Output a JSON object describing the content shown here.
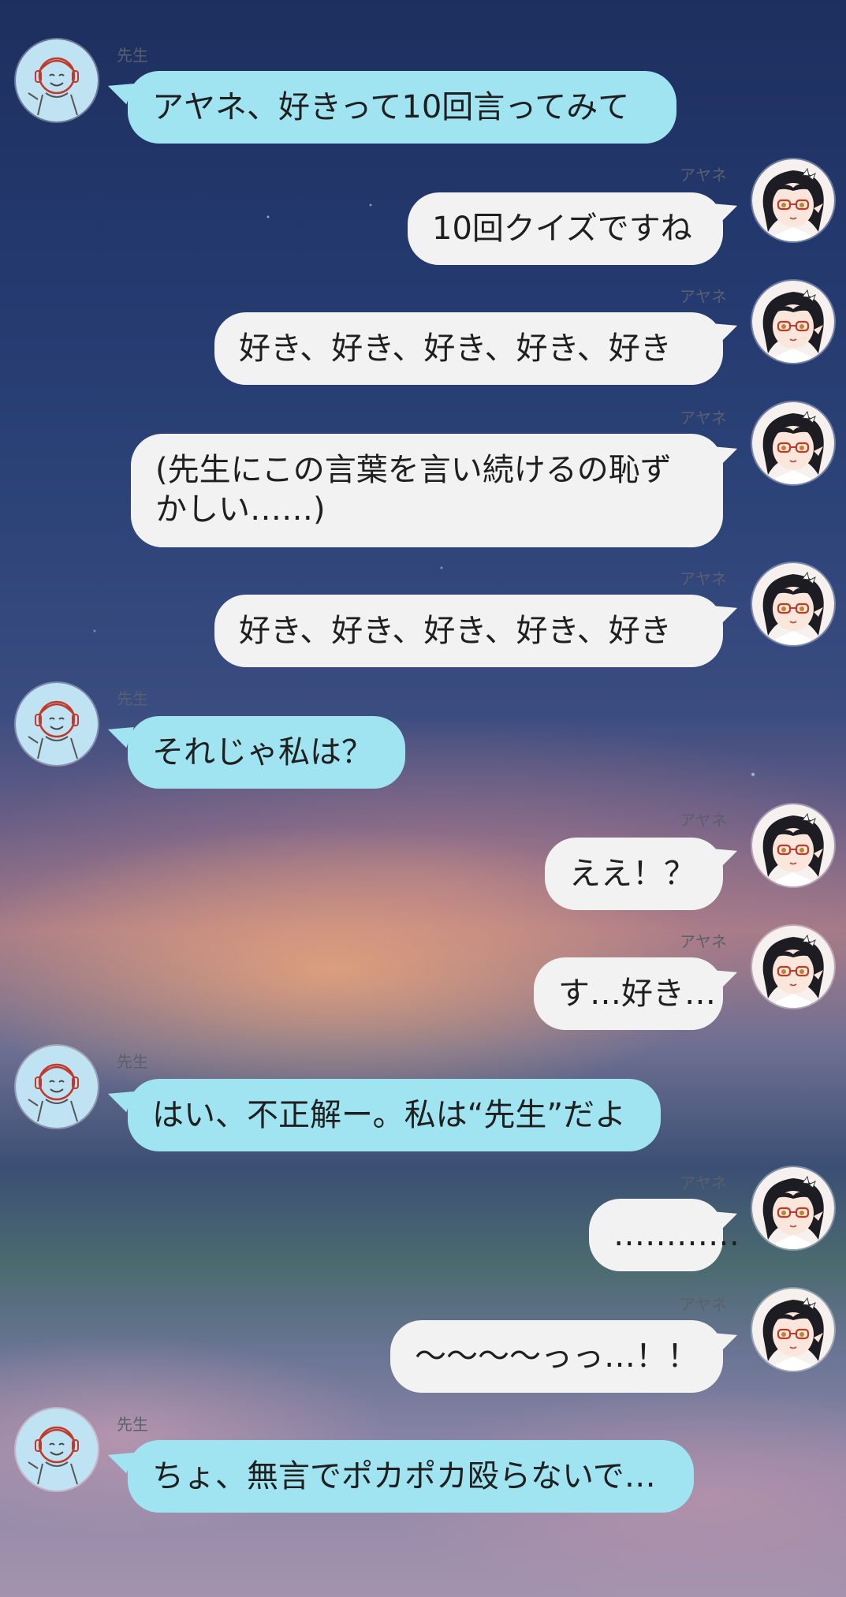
{
  "chat": {
    "participants": {
      "sensei": "先生",
      "ayane": "アヤネ"
    },
    "messages": [
      {
        "from": "sensei",
        "name": "先生",
        "text": "アヤネ、好きって10回言ってみて"
      },
      {
        "from": "ayane",
        "name": "アヤネ",
        "text": "10回クイズですね"
      },
      {
        "from": "ayane",
        "name": "アヤネ",
        "text": "好き、好き、好き、好き、好き"
      },
      {
        "from": "ayane",
        "name": "アヤネ",
        "text": "(先生にこの言葉を言い続けるの恥ずかしい……)"
      },
      {
        "from": "ayane",
        "name": "アヤネ",
        "text": "好き、好き、好き、好き、好き"
      },
      {
        "from": "sensei",
        "name": "先生",
        "text": "それじゃ私は？"
      },
      {
        "from": "ayane",
        "name": "アヤネ",
        "text": "ええ！？"
      },
      {
        "from": "ayane",
        "name": "アヤネ",
        "text": "す…好き…"
      },
      {
        "from": "sensei",
        "name": "先生",
        "text": "はい、不正解ー。私は“先生”だよ"
      },
      {
        "from": "ayane",
        "name": "アヤネ",
        "text": "…………"
      },
      {
        "from": "ayane",
        "name": "アヤネ",
        "text": "〜〜〜〜っっ…！！"
      },
      {
        "from": "sensei",
        "name": "先生",
        "text": "ちょ、無言でポカポカ殴らないで…"
      }
    ]
  },
  "colors": {
    "sensei_bubble": "#a0e4f1",
    "ayane_bubble": "#f2f2f2",
    "name_text": "#5b5f6b"
  },
  "icons": {
    "sensei_avatar": "sensei-avatar-icon",
    "ayane_avatar": "ayane-avatar-icon"
  }
}
